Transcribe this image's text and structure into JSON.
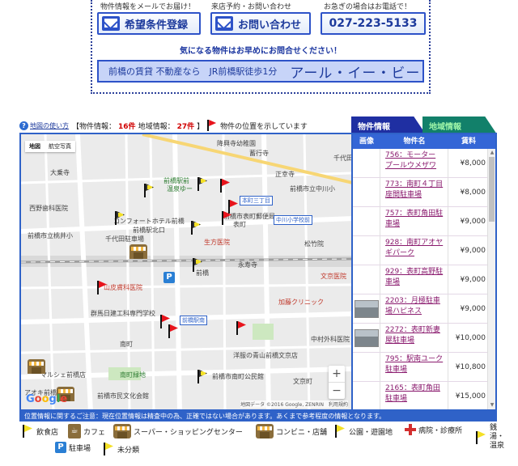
{
  "banner": {
    "caption_register": "物件情報をメールでお届け！",
    "caption_contact": "来店予約・お問い合わせ",
    "caption_phone": "お急ぎの場合はお電話で！",
    "register_label": "希望条件登録",
    "contact_label": "お問い合わせ",
    "phone_label": "027-223-5133",
    "notice": "気になる物件はお早めにお問合せください！",
    "agency_small": "前橋の賃貸 不動産なら　JR前橋駅徒歩1分",
    "agency_big": "アール・イー・ビー"
  },
  "widget": {
    "howto_label": "地図の使い方",
    "open_bracket": "【",
    "property_label": "物件情報：",
    "property_count": "16件",
    "area_label": "地域情報：",
    "area_count": "27件",
    "close_bracket": "】",
    "flag_note": "物件の位置を示しています"
  },
  "tabs": {
    "property": "物件情報",
    "area": "地域情報"
  },
  "map": {
    "type_map": "地図",
    "type_satellite": "航空写真",
    "zoom_in": "+",
    "zoom_out": "−",
    "google": "Google",
    "attribution": "地図データ ©2016 Google, ZENRIN　利用規約",
    "labels": {
      "l1": "降興寺幼稚園",
      "l2": "蓄行寺",
      "l3": "大乗寺",
      "l4": "正幸寺",
      "l5": "千代田町",
      "l6": "前橋駅前",
      "l7": "温泉ゆー",
      "l8": "本町三丁目",
      "l9": "前橋市立中川小",
      "l10": "西野歯科医院",
      "l11": "コンフォートホテル前橋",
      "l12": "前橋駅北口",
      "l13": "前橋市立桃井小",
      "l14": "千代田駐車場",
      "l15": "前橋市表町郵便局",
      "l16": "表町",
      "l17": "中川小学校前",
      "l18": "松竹院",
      "l19": "生方医院",
      "l20": "永寿寺",
      "l21": "前橋",
      "l22": "山皮膚科医院",
      "l23": "文京医院",
      "l24": "加藤クリニック",
      "l25": "群馬日建工科専門学校",
      "l26": "前橋駅南",
      "l27": "南町",
      "l28": "中村外科医院",
      "l29": "洋服の青山前橋文京店",
      "l30": "前橋市南町公民館",
      "l31": "南町緑地",
      "l32": "マルシェ前橋店",
      "l33": "アオキ前橋",
      "l34": "前橋市民文化会館",
      "l35": "文京町"
    }
  },
  "table": {
    "col_image": "画像",
    "col_name": "物件名",
    "col_price": "賃料",
    "rows": [
      {
        "name": "756：モーター\nプールウメザワ",
        "price": "¥8,000",
        "photo": false
      },
      {
        "name": "773：南町４丁目\n座間駐車場",
        "price": "¥8,000",
        "photo": false
      },
      {
        "name": "757：表町角田駐\n車場",
        "price": "¥9,000",
        "photo": false
      },
      {
        "name": "928：南町アオヤ\nギパーク",
        "price": "¥9,000",
        "photo": false
      },
      {
        "name": "929：表町高野駐\n車場",
        "price": "¥9,000",
        "photo": false
      },
      {
        "name": "2203：月極駐車\n場ハピネス",
        "price": "¥9,000",
        "photo": true
      },
      {
        "name": "2272：表町新妻\n屋駐車場",
        "price": "¥10,000",
        "photo": true
      },
      {
        "name": "795：駅南ユーク\n駐車場",
        "price": "¥10,800",
        "photo": false
      },
      {
        "name": "2165：表町角田\n駐車場",
        "price": "¥15,000",
        "photo": false
      }
    ]
  },
  "infobar": "位置情報に関するご注意：現在位置情報は精査中の為、正確ではない場合があります。あくまで参考程度の情報となります。",
  "legend": {
    "restaurant": "飲食店",
    "cafe": "カフェ",
    "supermarket": "スーパー・ショッピングセンター",
    "convenience": "コンビニ・店舗",
    "park": "公園・遊園地",
    "hospital": "病院・診療所",
    "bath": "銭湯・温泉",
    "parking": "駐車場",
    "unclassified": "未分類"
  }
}
